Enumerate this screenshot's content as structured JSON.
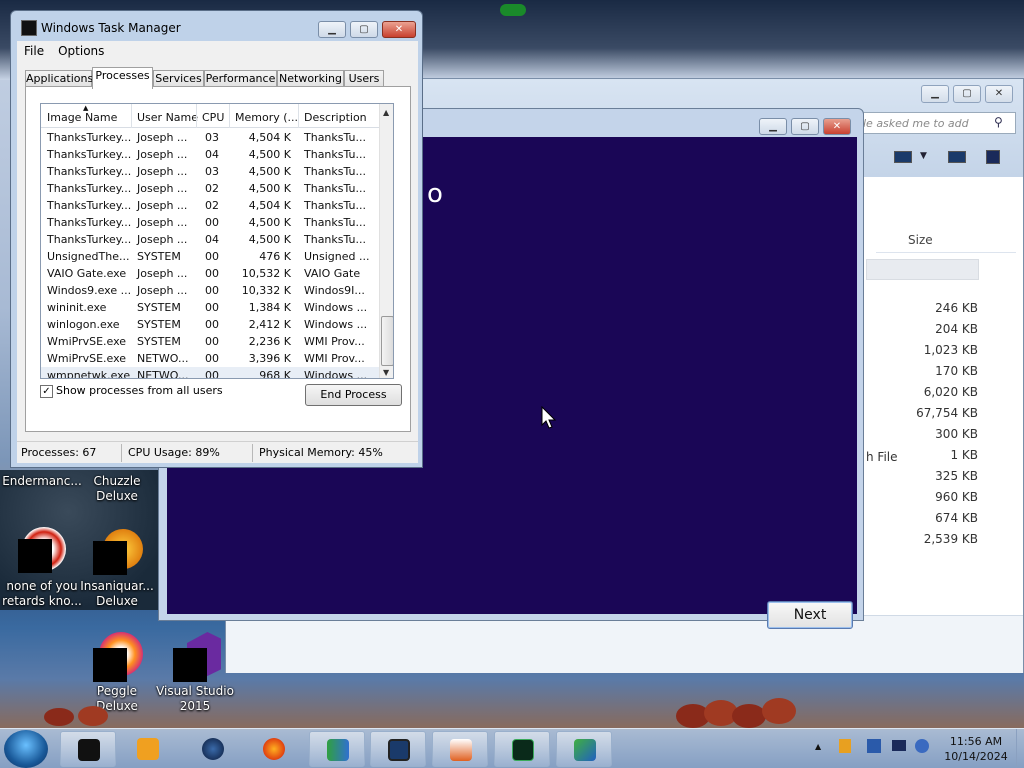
{
  "task_manager": {
    "title": "Windows Task Manager",
    "menu": [
      "File",
      "Options"
    ],
    "tabs": [
      "Applications",
      "Processes",
      "Services",
      "Performance",
      "Networking",
      "Users"
    ],
    "active_tab": "Processes",
    "columns": [
      "Image Name",
      "User Name",
      "CPU",
      "Memory (...",
      "Description"
    ],
    "rows": [
      {
        "name": "ThanksTurkey...",
        "user": "Joseph ...",
        "cpu": "03",
        "mem": "4,504 K",
        "desc": "ThanksTu..."
      },
      {
        "name": "ThanksTurkey...",
        "user": "Joseph ...",
        "cpu": "04",
        "mem": "4,500 K",
        "desc": "ThanksTu..."
      },
      {
        "name": "ThanksTurkey...",
        "user": "Joseph ...",
        "cpu": "03",
        "mem": "4,500 K",
        "desc": "ThanksTu..."
      },
      {
        "name": "ThanksTurkey...",
        "user": "Joseph ...",
        "cpu": "02",
        "mem": "4,500 K",
        "desc": "ThanksTu..."
      },
      {
        "name": "ThanksTurkey...",
        "user": "Joseph ...",
        "cpu": "02",
        "mem": "4,504 K",
        "desc": "ThanksTu..."
      },
      {
        "name": "ThanksTurkey...",
        "user": "Joseph ...",
        "cpu": "00",
        "mem": "4,500 K",
        "desc": "ThanksTu..."
      },
      {
        "name": "ThanksTurkey...",
        "user": "Joseph ...",
        "cpu": "04",
        "mem": "4,500 K",
        "desc": "ThanksTu..."
      },
      {
        "name": "UnsignedThe...",
        "user": "SYSTEM",
        "cpu": "00",
        "mem": "476 K",
        "desc": "Unsigned ..."
      },
      {
        "name": "VAIO Gate.exe",
        "user": "Joseph ...",
        "cpu": "00",
        "mem": "10,532 K",
        "desc": "VAIO Gate"
      },
      {
        "name": "Windos9.exe ...",
        "user": "Joseph ...",
        "cpu": "00",
        "mem": "10,332 K",
        "desc": "Windos9I..."
      },
      {
        "name": "wininit.exe",
        "user": "SYSTEM",
        "cpu": "00",
        "mem": "1,384 K",
        "desc": "Windows ..."
      },
      {
        "name": "winlogon.exe",
        "user": "SYSTEM",
        "cpu": "00",
        "mem": "2,412 K",
        "desc": "Windows ..."
      },
      {
        "name": "WmiPrvSE.exe",
        "user": "SYSTEM",
        "cpu": "00",
        "mem": "2,236 K",
        "desc": "WMI Prov..."
      },
      {
        "name": "WmiPrvSE.exe",
        "user": "NETWO...",
        "cpu": "00",
        "mem": "3,396 K",
        "desc": "WMI Prov..."
      },
      {
        "name": "wmpnetwk.exe",
        "user": "NETWO...",
        "cpu": "00",
        "mem": "968 K",
        "desc": "Windows ..."
      }
    ],
    "show_all_label": "Show processes from all users",
    "show_all_checked": "✓",
    "end_process_label": "End Process",
    "status": {
      "processes": "Processes: 67",
      "cpu": "CPU Usage: 89%",
      "memory": "Physical Memory: 45%"
    }
  },
  "installer": {
    "heading_fragment": "o",
    "next_label": "Next"
  },
  "explorer": {
    "search_placeholder": "le asked me to add",
    "size_header": "Size",
    "file_type_fragment": "h File",
    "sizes": [
      "246 KB",
      "204 KB",
      "1,023 KB",
      "170 KB",
      "6,020 KB",
      "67,754 KB",
      "300 KB",
      "1 KB",
      "325 KB",
      "960 KB",
      "674 KB",
      "2,539 KB"
    ]
  },
  "desktop_icons": [
    {
      "label": "Endermanc...",
      "label2": ""
    },
    {
      "label": "Chuzzle",
      "label2": "Deluxe"
    },
    {
      "label": "none of you",
      "label2": "retards kno..."
    },
    {
      "label": "Insaniquar...",
      "label2": "Deluxe"
    },
    {
      "label": "Peggle Deluxe",
      "label2": ""
    },
    {
      "label": "Visual Studio",
      "label2": "2015"
    }
  ],
  "clock": {
    "time": "11:56 AM",
    "date": "10/14/2024"
  },
  "colors": {
    "installer_bg": "#1a0656",
    "taskbar": "#a8bcd8"
  }
}
